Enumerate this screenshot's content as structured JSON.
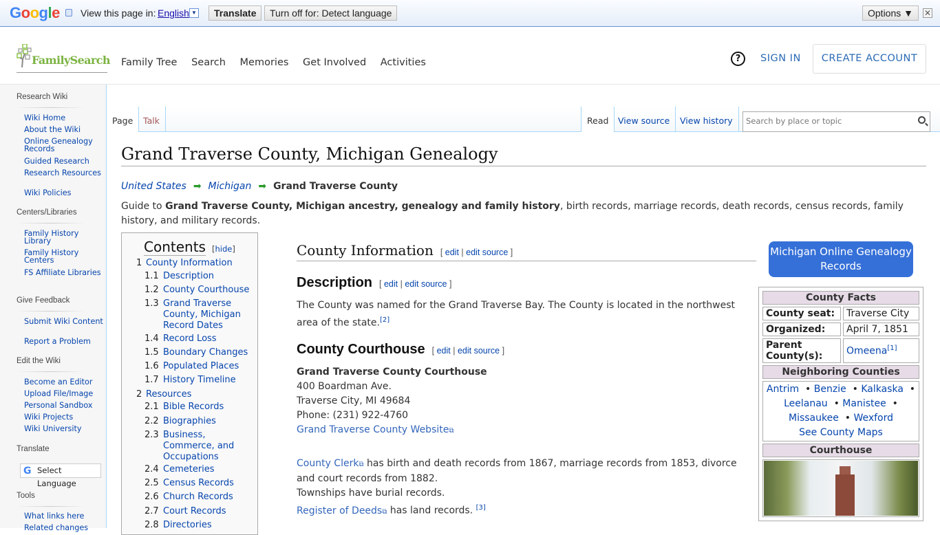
{
  "translate_bar": {
    "brand": "Google",
    "view_text": "View this page in:",
    "language": "English",
    "translate_button": "Translate",
    "turn_off_button": "Turn off for: Detect language",
    "options_button": "Options ▼",
    "close": "✕"
  },
  "header": {
    "logo_text": "FamilySearch",
    "nav": [
      "Family Tree",
      "Search",
      "Memories",
      "Get Involved",
      "Activities"
    ],
    "help": "?",
    "sign_in": "SIGN IN",
    "create_account": "CREATE ACCOUNT"
  },
  "sidebar": {
    "sections": [
      {
        "title": "Research Wiki",
        "items": [
          "Wiki Home",
          "About the Wiki",
          "Online Genealogy Records",
          "Guided Research",
          "Research Resources",
          "Wiki Policies"
        ]
      },
      {
        "title": "Centers/Libraries",
        "items": [
          "Family History Library",
          "Family History Centers",
          "FS Affiliate Libraries"
        ]
      },
      {
        "title": "Give Feedback",
        "items": [
          "Submit Wiki Content",
          "Report a Problem"
        ]
      },
      {
        "title": "Edit the Wiki",
        "items": [
          "Become an Editor",
          "Upload File/Image",
          "Personal Sandbox",
          "Wiki Projects",
          "Wiki University"
        ]
      },
      {
        "title": "Translate",
        "items": []
      },
      {
        "title": "Tools",
        "items": [
          "What links here",
          "Related changes"
        ]
      }
    ],
    "select_language": "Select Language"
  },
  "tabs": {
    "left": [
      "Page",
      "Talk"
    ],
    "right": [
      "Read",
      "View source",
      "View history"
    ],
    "search_placeholder": "Search by place or topic"
  },
  "page": {
    "title": "Grand Traverse County, Michigan Genealogy",
    "breadcrumb": [
      "United States",
      "Michigan",
      "Grand Traverse County"
    ],
    "intro_prefix": "Guide to ",
    "intro_bold": "Grand Traverse County, Michigan ancestry, genealogy and family history",
    "intro_suffix": ", birth records, marriage records, death records, census records, family history, and military records."
  },
  "toc": {
    "title": "Contents",
    "hide": "hide",
    "items": [
      {
        "num": "1",
        "label": "County Information"
      },
      {
        "num": "1.1",
        "label": "Description"
      },
      {
        "num": "1.2",
        "label": "County Courthouse"
      },
      {
        "num": "1.3",
        "label": "Grand Traverse County, Michigan Record Dates"
      },
      {
        "num": "1.4",
        "label": "Record Loss"
      },
      {
        "num": "1.5",
        "label": "Boundary Changes"
      },
      {
        "num": "1.6",
        "label": "Populated Places"
      },
      {
        "num": "1.7",
        "label": "History Timeline"
      },
      {
        "num": "2",
        "label": "Resources"
      },
      {
        "num": "2.1",
        "label": "Bible Records"
      },
      {
        "num": "2.2",
        "label": "Biographies"
      },
      {
        "num": "2.3",
        "label": "Business, Commerce, and Occupations"
      },
      {
        "num": "2.4",
        "label": "Cemeteries"
      },
      {
        "num": "2.5",
        "label": "Census Records"
      },
      {
        "num": "2.6",
        "label": "Church Records"
      },
      {
        "num": "2.7",
        "label": "Court Records"
      },
      {
        "num": "2.8",
        "label": "Directories"
      }
    ]
  },
  "sections": {
    "edit": "edit",
    "edit_source": "edit source",
    "county_info": "County Information",
    "description": "Description",
    "description_text": "The County was named for the Grand Traverse Bay. The County is located in the northwest area of the state.",
    "description_ref": "[2]",
    "courthouse": "County Courthouse",
    "courthouse_name": "Grand Traverse County Courthouse",
    "address1": "400 Boardman Ave.",
    "address2": "Traverse City, MI 49684",
    "phone": "Phone: (231) 922-4760",
    "website": "Grand Traverse County Website",
    "clerk_link": "County Clerk",
    "clerk_text": " has birth and death records from 1867, marriage records from 1853, divorce and court records from 1882.",
    "townships": "Townships have burial records.",
    "deeds_link": "Register of Deeds",
    "deeds_text": " has land records. ",
    "deeds_ref": "[3]"
  },
  "infobox": {
    "button": "Michigan Online Genealogy Records",
    "facts_title": "County Facts",
    "county_seat_label": "County seat:",
    "county_seat": "Traverse City",
    "organized_label": "Organized:",
    "organized": "April 7, 1851",
    "parent_label": "Parent County(s):",
    "parent": "Omeena",
    "parent_ref": "[1]",
    "neighbors_title": "Neighboring Counties",
    "neighbors": [
      "Antrim",
      "Benzie",
      "Kalkaska",
      "Leelanau",
      "Manistee",
      "Missaukee",
      "Wexford"
    ],
    "see_maps": "See County Maps",
    "courthouse_title": "Courthouse"
  }
}
